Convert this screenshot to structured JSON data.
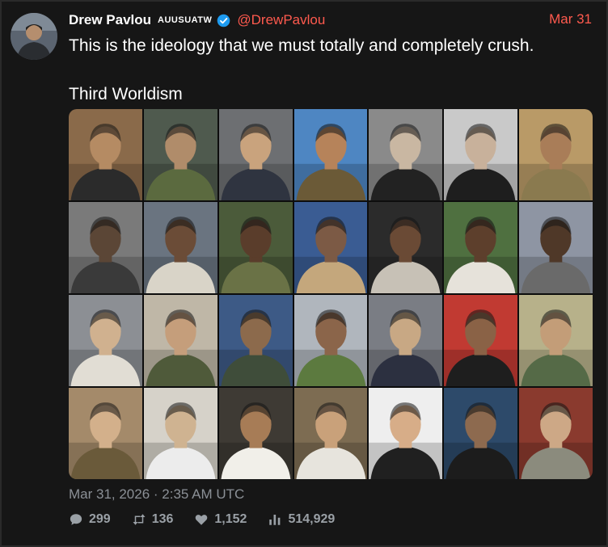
{
  "tweet": {
    "author_name": "Drew Pavlou",
    "flair": "AUUSUATW",
    "handle": "@DrewPavlou",
    "date_short": "Mar 31",
    "text": "This is the ideology that we must totally and completely crush.\n\nThird Worldism",
    "timestamp": "Mar 31, 2026 · 2:35 AM UTC"
  },
  "stats": {
    "replies": "299",
    "retweets": "136",
    "likes": "1,152",
    "views": "514,929"
  },
  "colors": {
    "accent": "#ff5a4e",
    "verified": "#1d9bf0",
    "background": "#161616"
  },
  "collage": {
    "rows": 4,
    "columns": 7,
    "tiles": [
      {
        "bg": "#8a6a4a",
        "skin": "#b58b63",
        "cloth": "#2b2b2b"
      },
      {
        "bg": "#4f5a4e",
        "skin": "#b08c6a",
        "cloth": "#5b6a3f"
      },
      {
        "bg": "#6d6f72",
        "skin": "#c9a37d",
        "cloth": "#2f3440"
      },
      {
        "bg": "#4e86c2",
        "skin": "#b6835a",
        "cloth": "#6b5a37"
      },
      {
        "bg": "#8a8a8a",
        "skin": "#c9b7a2",
        "cloth": "#222222"
      },
      {
        "bg": "#c9c9c9",
        "skin": "#c8b19b",
        "cloth": "#1e1e1e"
      },
      {
        "bg": "#b99a67",
        "skin": "#a97d58",
        "cloth": "#8a7a4f"
      },
      {
        "bg": "#7a7a7a",
        "skin": "#5b4636",
        "cloth": "#3a3a3a"
      },
      {
        "bg": "#6a7480",
        "skin": "#6b4c37",
        "cloth": "#d9d4c8"
      },
      {
        "bg": "#4b5b3a",
        "skin": "#5a3d2b",
        "cloth": "#6a7246"
      },
      {
        "bg": "#3a5c93",
        "skin": "#7c5a45",
        "cloth": "#c4a77c"
      },
      {
        "bg": "#2b2b2b",
        "skin": "#6a4a35",
        "cloth": "#c7c1b6"
      },
      {
        "bg": "#4f7040",
        "skin": "#5d3f2c",
        "cloth": "#e6e2da"
      },
      {
        "bg": "#8e95a3",
        "skin": "#4f3828",
        "cloth": "#6a6a6a"
      },
      {
        "bg": "#8c8f94",
        "skin": "#d0b18f",
        "cloth": "#e1ddd4"
      },
      {
        "bg": "#bfb7a7",
        "skin": "#c59e7b",
        "cloth": "#4f5a3a"
      },
      {
        "bg": "#3d5a86",
        "skin": "#8c6a4c",
        "cloth": "#3f4d3a"
      },
      {
        "bg": "#b0b6bd",
        "skin": "#8b654a",
        "cloth": "#5c7a3f"
      },
      {
        "bg": "#7a7d84",
        "skin": "#c8a884",
        "cloth": "#2c3040"
      },
      {
        "bg": "#c13a32",
        "skin": "#8a6246",
        "cloth": "#1e1e1e"
      },
      {
        "bg": "#b7b18a",
        "skin": "#c39d78",
        "cloth": "#556a47"
      },
      {
        "bg": "#a48a6a",
        "skin": "#d3b08b",
        "cloth": "#6a5a3a"
      },
      {
        "bg": "#d6d2c9",
        "skin": "#cfb391",
        "cloth": "#ececec"
      },
      {
        "bg": "#3e3a34",
        "skin": "#a77c56",
        "cloth": "#f1efe9"
      },
      {
        "bg": "#7d6c52",
        "skin": "#c9a17a",
        "cloth": "#e7e4dd"
      },
      {
        "bg": "#eeeeee",
        "skin": "#d7ad88",
        "cloth": "#202020"
      },
      {
        "bg": "#2d4a6a",
        "skin": "#8d6a4f",
        "cloth": "#1c1c1c"
      },
      {
        "bg": "#8a3a2e",
        "skin": "#cda886",
        "cloth": "#8b8b7d"
      }
    ]
  }
}
